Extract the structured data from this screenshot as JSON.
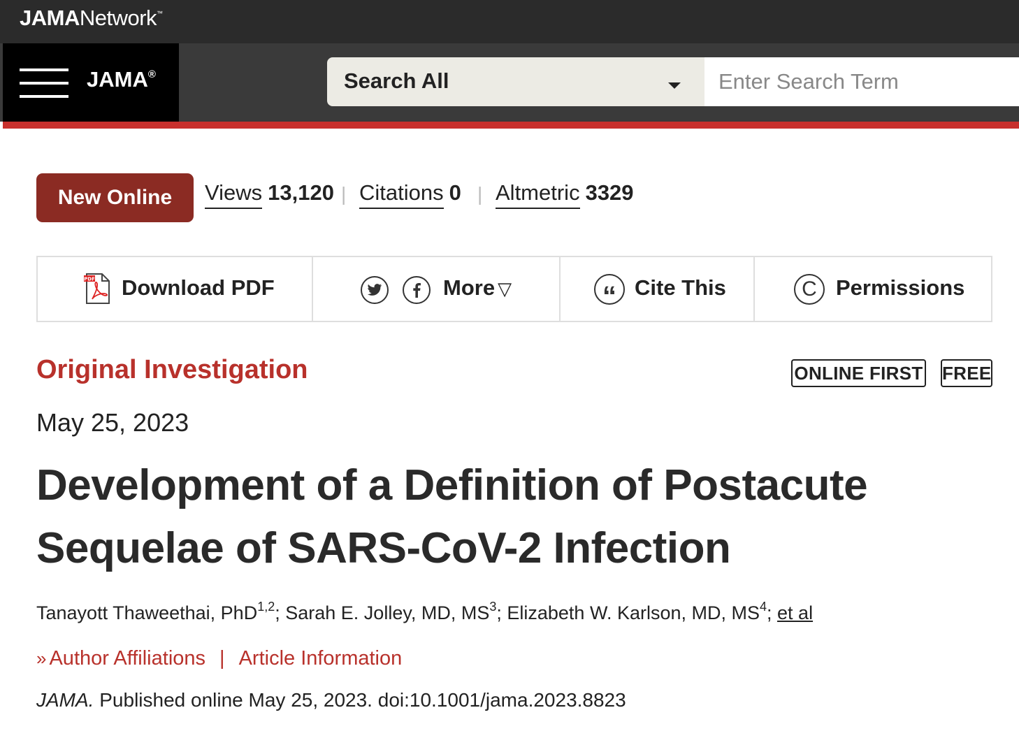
{
  "network_bar": {
    "logo_bold": "JAMA",
    "logo_rest": "Network",
    "logo_tm": "™"
  },
  "nav": {
    "journal": "JAMA",
    "journal_mark": "®",
    "search_scope": "Search All",
    "search_placeholder": "Enter Search Term"
  },
  "metrics": {
    "badge": "New Online",
    "views_label": "Views",
    "views_value": "13,120",
    "citations_label": "Citations",
    "citations_value": "0",
    "altmetric_label": "Altmetric",
    "altmetric_value": "3329",
    "separator": "|"
  },
  "toolbar": {
    "download_label": "Download PDF",
    "pdf_icon_text": "PDF",
    "twitter_icon": "twitter-icon",
    "facebook_icon": "facebook-icon",
    "more_label": "More",
    "more_caret": "▽",
    "cite_label": "Cite This",
    "cite_icon_glyph": "“",
    "permissions_label": "Permissions",
    "permissions_icon_glyph": "C"
  },
  "article": {
    "type": "Original Investigation",
    "tags": [
      "ONLINE FIRST",
      "FREE"
    ],
    "date": "May 25, 2023",
    "title": "Development of a Definition of Postacute Sequelae of SARS-CoV-2 Infection",
    "authors": [
      {
        "name": "Tanayott Thaweethai, PhD",
        "sup": "1,2",
        "sep": "; "
      },
      {
        "name": "Sarah E. Jolley, MD, MS",
        "sup": "3",
        "sep": "; "
      },
      {
        "name": "Elizabeth W. Karlson, MD, MS",
        "sup": "4",
        "sep": "; "
      }
    ],
    "et_al": "et al",
    "affiliations_chevron": "»",
    "affiliations_link": "Author Affiliations",
    "links_divider": "|",
    "info_link": "Article Information",
    "citation_journal": "JAMA.",
    "citation_rest": " Published online May 25, 2023. doi:10.1001/jama.2023.8823"
  },
  "colors": {
    "accent_red": "#b8312b",
    "badge_red": "#8b2b23",
    "nav_red_line": "#c8302d",
    "top_bar": "#2b2b2b"
  }
}
